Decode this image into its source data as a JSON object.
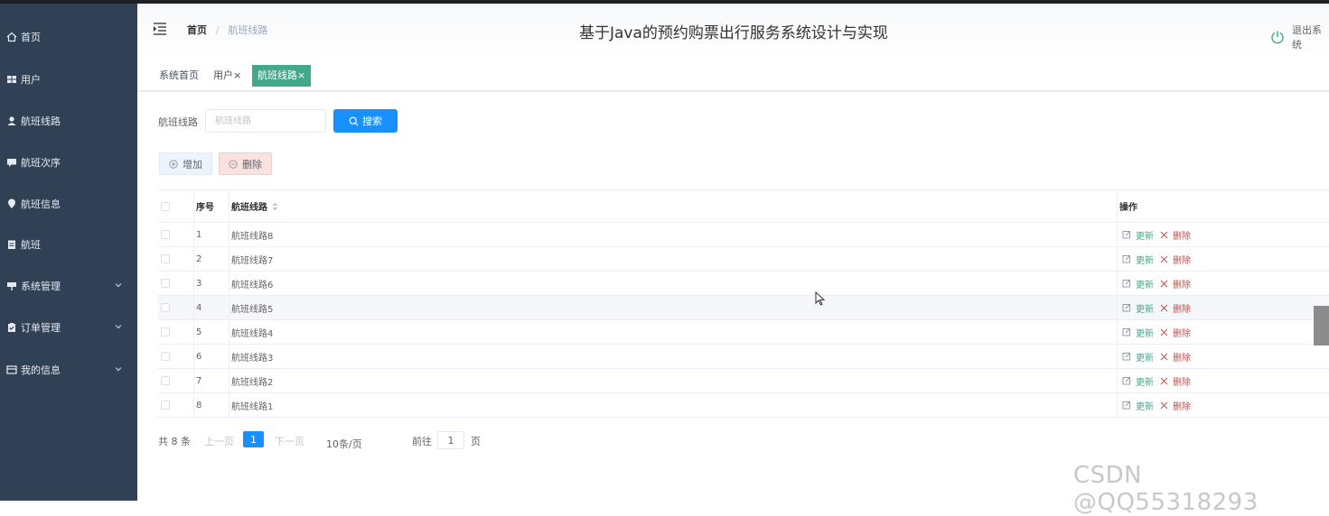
{
  "sidebar": {
    "items": [
      {
        "label": "首页",
        "icon": "home-icon"
      },
      {
        "label": "用户",
        "icon": "grid-icon"
      },
      {
        "label": "航班线路",
        "icon": "user-icon"
      },
      {
        "label": "航班次序",
        "icon": "comment-icon"
      },
      {
        "label": "航班信息",
        "icon": "location-icon"
      },
      {
        "label": "航班",
        "icon": "document-icon"
      },
      {
        "label": "系统管理",
        "icon": "sign-icon"
      },
      {
        "label": "订单管理",
        "icon": "clipboard-icon"
      },
      {
        "label": "我的信息",
        "icon": "card-icon"
      }
    ],
    "bg_color": "#304156"
  },
  "header": {
    "breadcrumb_home": "首页",
    "breadcrumb_sep": "/",
    "breadcrumb_current": "航班线路",
    "title": "基于Java的预约购票出行服务系统设计与实现",
    "logout_label": "退出系统"
  },
  "tags": [
    {
      "label": "系统首页"
    },
    {
      "label": "用户×"
    },
    {
      "label": "航班线路×",
      "active": true
    }
  ],
  "search": {
    "label": "航班线路",
    "placeholder": "航班线路",
    "button_label": "搜索"
  },
  "actions": {
    "add_label": "增加",
    "delete_label": "删除"
  },
  "table": {
    "columns": [
      "序号",
      "航班线路",
      "操作"
    ],
    "rows": [
      {
        "index": "1",
        "name": "航班线路8"
      },
      {
        "index": "2",
        "name": "航班线路7"
      },
      {
        "index": "3",
        "name": "航班线路6"
      },
      {
        "index": "4",
        "name": "航班线路5"
      },
      {
        "index": "5",
        "name": "航班线路4"
      },
      {
        "index": "6",
        "name": "航班线路3"
      },
      {
        "index": "7",
        "name": "航班线路2"
      },
      {
        "index": "8",
        "name": "航班线路1"
      }
    ],
    "edit_label": "更新",
    "delete_label": "删除"
  },
  "pagination": {
    "total": "共 8 条",
    "prev": "上一页",
    "current_page": "1",
    "next": "下一页",
    "page_size": "10条/页",
    "goto": "前往",
    "goto_value": "1",
    "page_unit": "页"
  },
  "watermark": "CSDN @QQ55318293",
  "colors": {
    "accent_green": "#42a88a",
    "primary_blue": "#1890ff",
    "danger_red": "#c0504d"
  }
}
